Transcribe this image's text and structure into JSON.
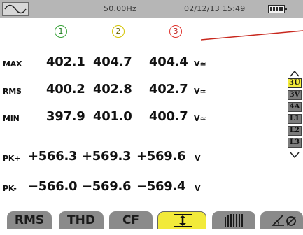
{
  "status_bar": {
    "wave_icon": "sine-wave-icon",
    "frequency": "50.00Hz",
    "datetime": "02/12/13  15:49",
    "battery_icon": "battery-icon"
  },
  "phases": [
    {
      "label": "1",
      "color": "#3aa43a"
    },
    {
      "label": "2",
      "color": "#d4c400"
    },
    {
      "label": "3",
      "color": "#e0302a"
    }
  ],
  "rows": [
    {
      "label": "MAX",
      "values": [
        "402.1",
        "404.7",
        "404.4"
      ],
      "unit": "V≃"
    },
    {
      "label": "RMS",
      "values": [
        "400.2",
        "402.8",
        "402.7"
      ],
      "unit": "V≃"
    },
    {
      "label": "MIN",
      "values": [
        "397.9",
        "401.0",
        "400.7"
      ],
      "unit": "V≃"
    },
    {
      "label": "PK+",
      "values": [
        "+566.3",
        "+569.3",
        "+569.6"
      ],
      "unit": "V"
    },
    {
      "label": "PK-",
      "values": [
        "−566.0",
        "−569.6",
        "−569.4"
      ],
      "unit": "V"
    }
  ],
  "side_selector": {
    "items": [
      "3U",
      "3V",
      "4A",
      "L1",
      "L2",
      "L3"
    ],
    "selected": "3U",
    "selected_color": "#f4ec3a"
  },
  "tabs": {
    "rms": "RMS",
    "thd": "THD",
    "cf": "CF",
    "minmax_icon": "min-max-arrows-icon",
    "harmonics_icon": "bar-graph-icon",
    "phase_icon": "phase-angle-icon",
    "selected_color": "#f2ea3a"
  }
}
